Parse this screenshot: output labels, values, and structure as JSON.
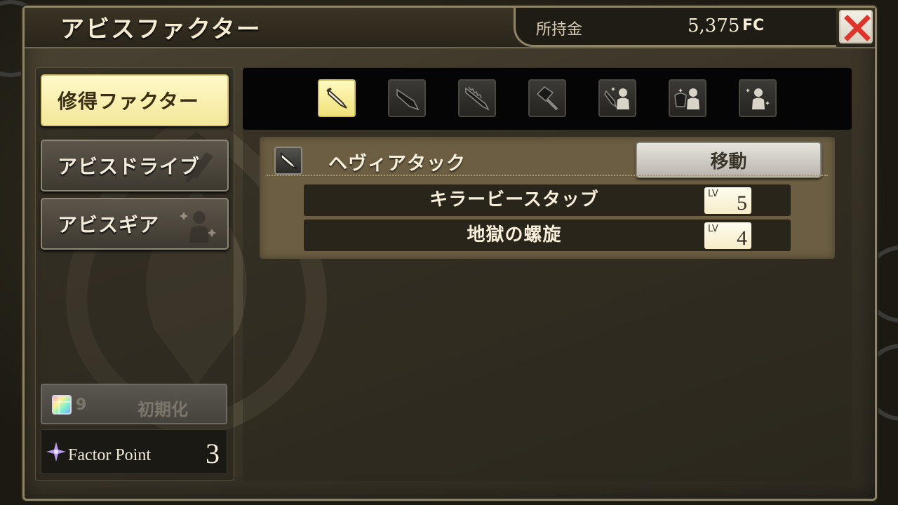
{
  "window": {
    "title": "アビスファクター"
  },
  "money": {
    "label": "所持金",
    "value": "5,375",
    "unit": "FC"
  },
  "close": {
    "icon": "close-x-icon",
    "color": "#e0332a"
  },
  "menu": [
    {
      "label": "修得ファクター",
      "active": true
    },
    {
      "label": "アビスドライブ",
      "active": false
    },
    {
      "label": "アビスギア",
      "active": false
    }
  ],
  "reset": {
    "count": "9",
    "label": "初期化",
    "icon": "prism-cube-icon"
  },
  "factor": {
    "label": "Factor Point",
    "value": "3",
    "icon": "sparkle-icon"
  },
  "tabs": [
    {
      "icon": "light-blade-icon",
      "active": true
    },
    {
      "icon": "broad-blade-icon",
      "active": false
    },
    {
      "icon": "saw-blade-icon",
      "active": false
    },
    {
      "icon": "hammer-icon",
      "active": false
    },
    {
      "icon": "blade-character-icon",
      "active": false
    },
    {
      "icon": "armor-character-icon",
      "active": false
    },
    {
      "icon": "character-sparkle-icon",
      "active": false
    }
  ],
  "skill": {
    "name": "ヘヴィアタック",
    "move_label": "移動",
    "subs": [
      {
        "name": "キラービースタッブ",
        "lv_tag": "LV",
        "level": "5"
      },
      {
        "name": "地獄の螺旋",
        "lv_tag": "LV",
        "level": "4"
      }
    ]
  },
  "colors": {
    "accent_active": "#f3e79a",
    "panel": "#6b5e42",
    "frame": "#8f8568"
  }
}
